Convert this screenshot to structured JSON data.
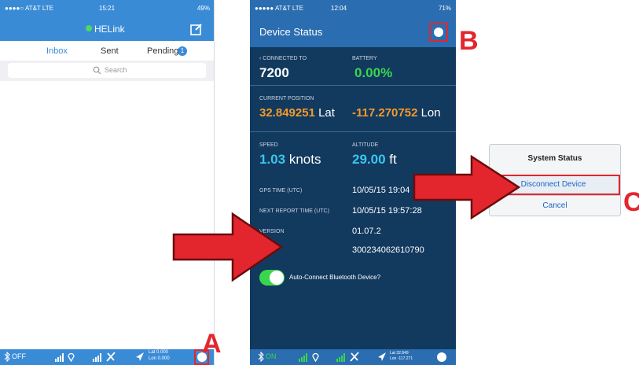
{
  "left_phone": {
    "status_bar": {
      "carrier": "●●●●○ AT&T LTE",
      "time": "15:21",
      "battery": "49%"
    },
    "nav": {
      "title": "HELink",
      "compose_icon": "compose-icon"
    },
    "tabs": [
      {
        "label": "Inbox",
        "selected": true
      },
      {
        "label": "Sent",
        "selected": false
      },
      {
        "label": "Pending",
        "selected": false,
        "badge": "1"
      }
    ],
    "search": {
      "placeholder": "Search"
    },
    "bottom_bar": {
      "bluetooth": "OFF",
      "location": {
        "lat": "Lat 0.000",
        "lon": "Lon 0.000"
      }
    }
  },
  "right_phone": {
    "status_bar": {
      "carrier": "●●●●● AT&T LTE",
      "time": "12:04",
      "battery": "71%"
    },
    "nav": {
      "title": "Device Status"
    },
    "connected": {
      "label": "CONNECTED TO",
      "value": "7200"
    },
    "battery": {
      "label": "BATTERY",
      "value": "0.00%"
    },
    "position": {
      "label": "CURRENT POSITION",
      "lat_value": "32.849251",
      "lat_unit": "Lat",
      "lon_value": "-117.270752",
      "lon_unit": "Lon"
    },
    "speed": {
      "label": "SPEED",
      "value": "1.03",
      "unit": "knots"
    },
    "altitude": {
      "label": "ALTITUDE",
      "value": "29.00",
      "unit": "ft"
    },
    "gps_time": {
      "label": "GPS TIME (UTC)",
      "value": "10/05/15 19:04"
    },
    "next_report": {
      "label": "NEXT REPORT TIME (UTC)",
      "value": "10/05/15 19:57:28"
    },
    "version": {
      "label": "VERSION",
      "value": "01.07.2"
    },
    "device_id": "300234062610790",
    "auto_connect": {
      "label": "Auto-Connect Bluetooth Device?",
      "enabled": true
    },
    "bottom_bar": {
      "bluetooth": "ON",
      "location": {
        "lat": "Lat 32.849",
        "lon": "Lon -117.271"
      }
    }
  },
  "dialog": {
    "title": "System Status",
    "disconnect_label": "Disconnect Device",
    "cancel_label": "Cancel"
  },
  "callouts": {
    "a": "A",
    "b": "B",
    "c": "C"
  },
  "colors": {
    "left_accent": "#3a8bd6",
    "right_background": "#12395e",
    "highlight_red": "#e3262e",
    "value_green": "#39d64d",
    "value_orange": "#f49a2b",
    "value_cyan": "#39c6ee"
  }
}
